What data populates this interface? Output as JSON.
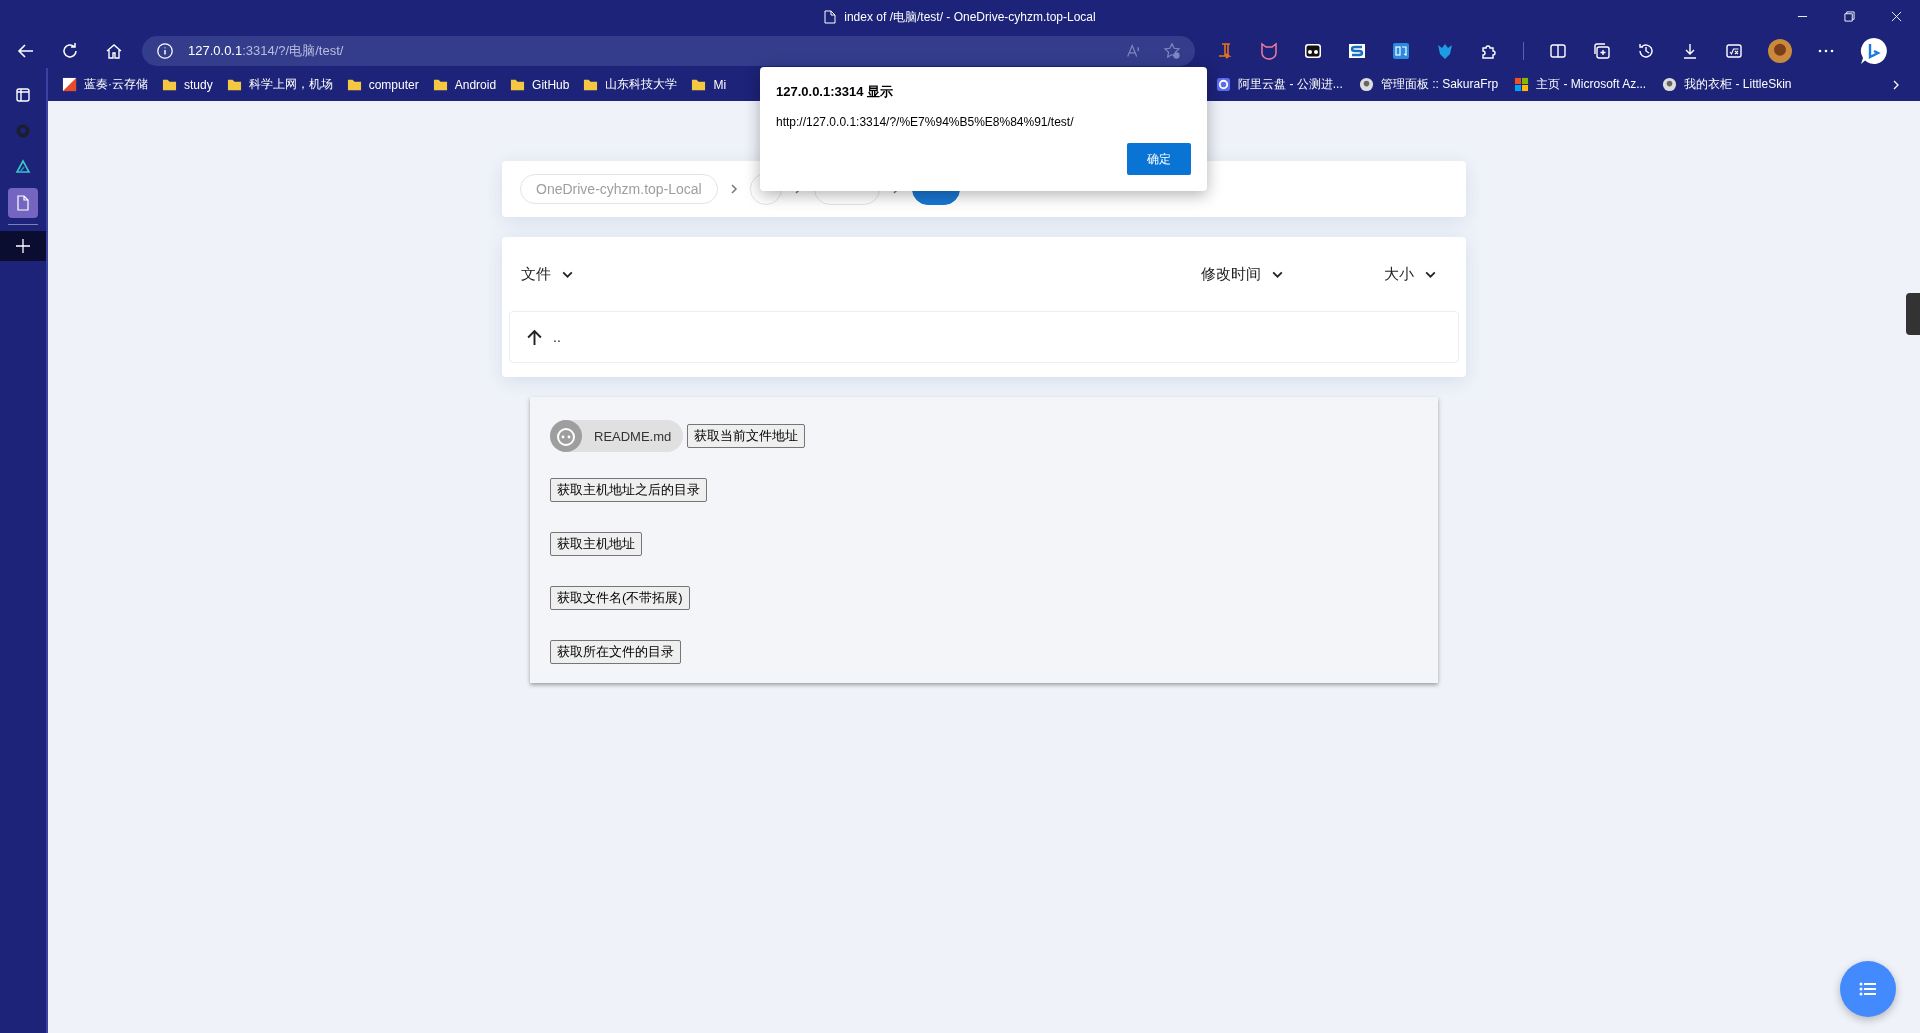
{
  "window": {
    "title": "index of /电脑/test/ - OneDrive-cyhzm.top-Local"
  },
  "address_bar": {
    "host": "127.0.0.1",
    "path": ":3314/?/电脑/test/"
  },
  "bookmarks_left": [
    {
      "label": "蓝奏·云存储",
      "kind": "logo"
    },
    {
      "label": "study",
      "kind": "folder"
    },
    {
      "label": "科学上网，机场",
      "kind": "folder"
    },
    {
      "label": "computer",
      "kind": "folder"
    },
    {
      "label": "Android",
      "kind": "folder"
    },
    {
      "label": "GitHub",
      "kind": "folder"
    },
    {
      "label": "山东科技大学",
      "kind": "folder"
    },
    {
      "label": "Mi",
      "kind": "folder"
    }
  ],
  "bookmarks_right": [
    {
      "label": "阿里云盘 - 公测进...",
      "kind": "cloud"
    },
    {
      "label": "管理面板 :: SakuraFrp",
      "kind": "avatar"
    },
    {
      "label": "主页 - Microsoft Az...",
      "kind": "windows"
    },
    {
      "label": "我的衣柜 - LittleSkin",
      "kind": "avatar"
    }
  ],
  "sidebar": {
    "items": [
      {
        "kind": "panel",
        "selected": false
      },
      {
        "kind": "github",
        "selected": false
      },
      {
        "kind": "triangle",
        "selected": false
      },
      {
        "kind": "document",
        "selected": true
      }
    ]
  },
  "breadcrumb": [
    {
      "label": "OneDrive-cyhzm.top-Local",
      "selected": false
    },
    {
      "selected": false
    },
    {
      "selected": false
    },
    {
      "selected": true
    }
  ],
  "file_list": {
    "columns": [
      "文件",
      "修改时间",
      "大小"
    ],
    "rows": [
      {
        "name": ".."
      }
    ]
  },
  "readme": {
    "chip": "README.md",
    "buttons": [
      "获取当前文件地址",
      "获取主机地址之后的目录",
      "获取主机地址",
      "获取文件名(不带拓展)",
      "获取所在文件的目录"
    ]
  },
  "dialog": {
    "title": "127.0.0.1:3314 显示",
    "message": "http://127.0.0.1:3314/?/%E7%94%B5%E8%84%91/test/",
    "button": "确定"
  }
}
